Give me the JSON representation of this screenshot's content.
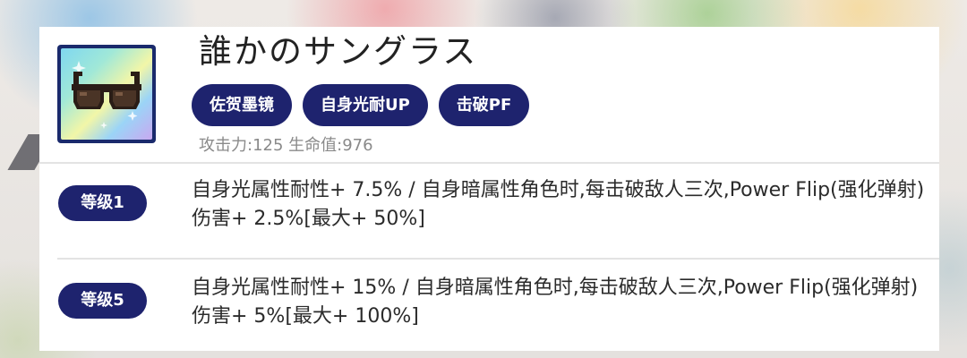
{
  "item": {
    "title": "誰かのサングラス",
    "tags": [
      "佐贺墨镜",
      "自身光耐UP",
      "击破PF"
    ],
    "stats": "攻击力:125 生命值:976",
    "icon": "sunglasses-icon"
  },
  "levels": [
    {
      "badge": "等级1",
      "description": "自身光属性耐性+ 7.5% / 自身暗属性角色时,每击破敌人三次,Power Flip(强化弹射)伤害+ 2.5%[最大+ 50%]"
    },
    {
      "badge": "等级5",
      "description": "自身光属性耐性+ 15% / 自身暗属性角色时,每击破敌人三次,Power Flip(强化弹射)伤害+ 5%[最大+ 100%]"
    }
  ],
  "colors": {
    "badge_bg": "#1e236e",
    "badge_text": "#ffffff",
    "card_bg": "#ffffff",
    "stats_text": "#8a8a8a"
  }
}
